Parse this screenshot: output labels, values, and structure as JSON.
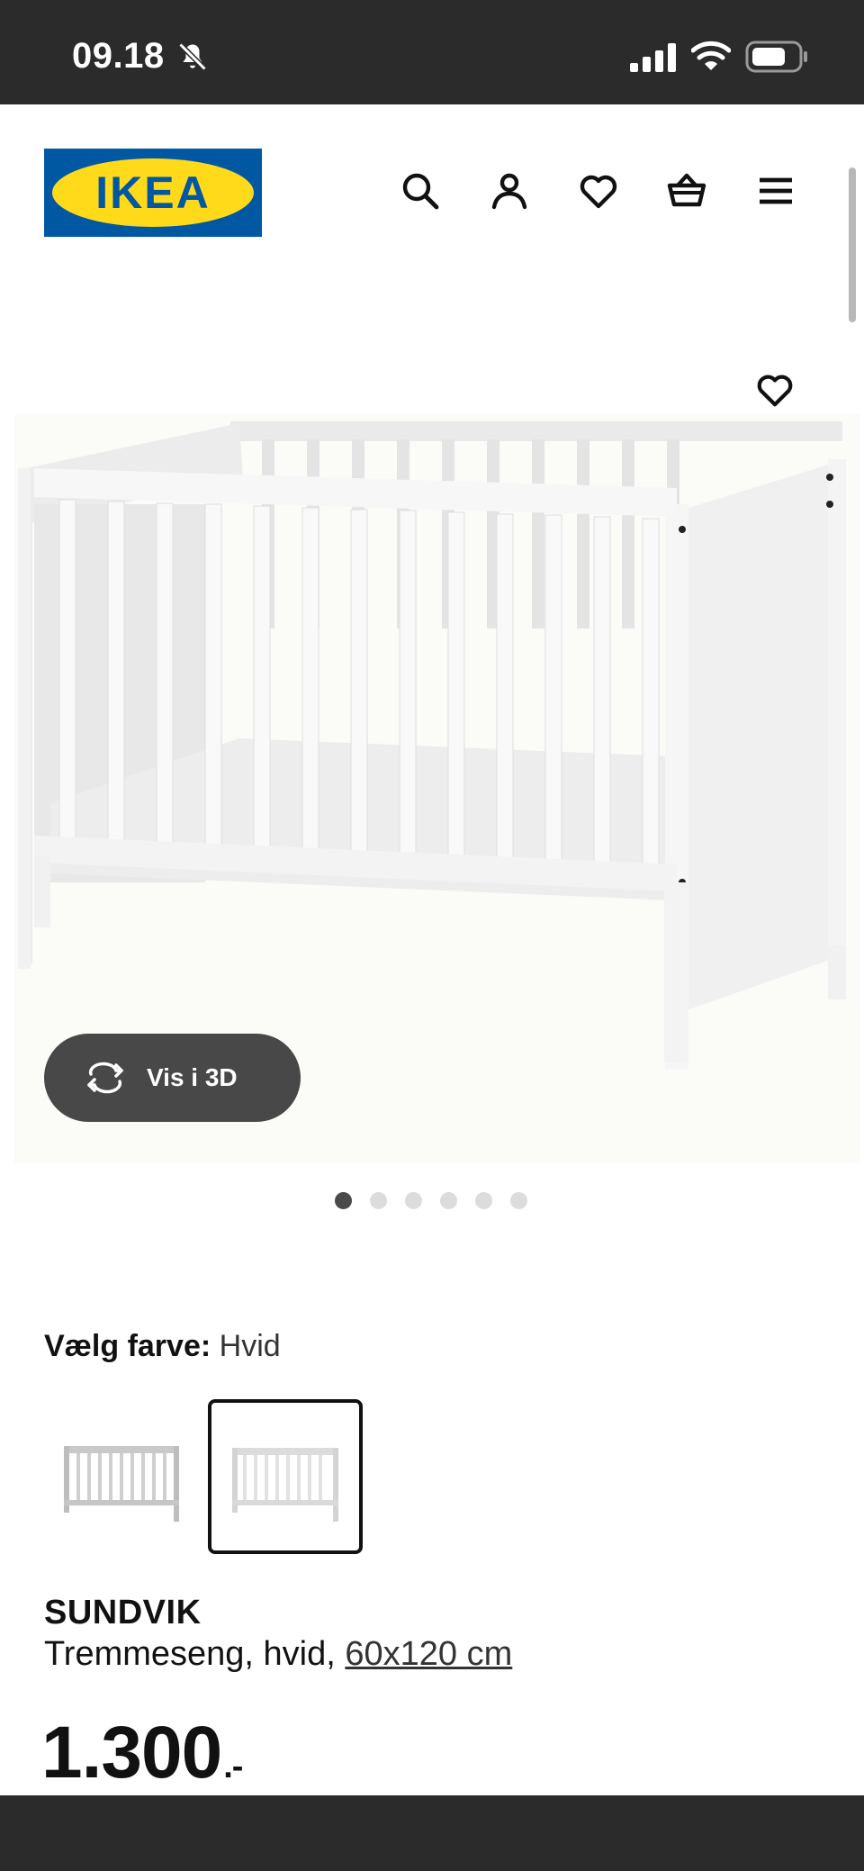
{
  "status_bar": {
    "time": "09.18",
    "icons": [
      "bell-slash-icon",
      "signal-icon",
      "wifi-icon",
      "battery-icon"
    ]
  },
  "header": {
    "logo_text": "IKEA",
    "brand_colors": {
      "blue": "#0058A3",
      "yellow": "#FFDA1A"
    },
    "nav_icons": [
      "search-icon",
      "account-icon",
      "wishlist-icon",
      "basket-icon",
      "menu-icon"
    ]
  },
  "gallery": {
    "view_3d_label": "Vis i 3D",
    "image_count": 6,
    "active_index": 0
  },
  "product": {
    "color_label": "Vælg farve:",
    "color_value": "Hvid",
    "name": "SUNDVIK",
    "desc_prefix": "Tremmeseng, hvid,",
    "size_link": "60x120 cm",
    "price_main": "1.300",
    "price_suffix": ".-"
  }
}
